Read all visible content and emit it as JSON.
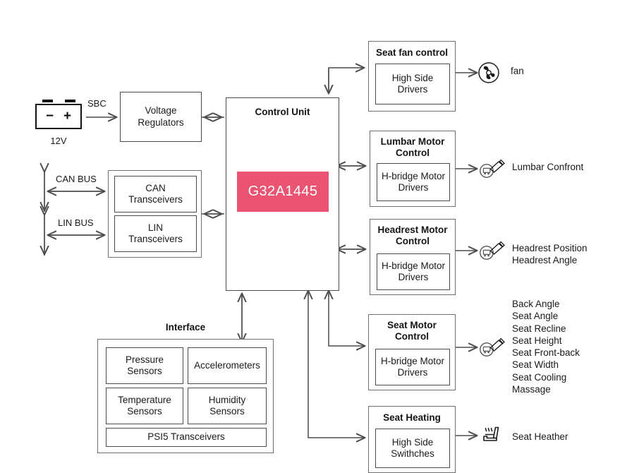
{
  "diagram": {
    "title_chip": "G32A1445",
    "accent_color": "#ea5472",
    "line_color": "#4c4c4c"
  },
  "power": {
    "battery_minus": "−",
    "battery_plus": "+",
    "battery_caption": "12V",
    "sbc_label": "SBC",
    "regulators_label": "Voltage\nRegulators"
  },
  "buses": [
    {
      "name": "CAN BUS",
      "transceiver": "CAN\nTransceivers"
    },
    {
      "name": "LIN BUS",
      "transceiver": "LIN\nTransceivers"
    }
  ],
  "control_unit": {
    "title": "Control Unit",
    "chip": "G32A1445"
  },
  "interface": {
    "title": "Interface",
    "blocks": [
      {
        "label": "Pressure\nSensors"
      },
      {
        "label": "Accelerometers"
      },
      {
        "label": "Temperature\nSensors"
      },
      {
        "label": "Humidity\nSensors"
      },
      {
        "label": "PSI5 Transceivers"
      }
    ]
  },
  "peripherals": [
    {
      "title": "Seat fan control",
      "driver": "High Side\nDrivers",
      "icon": "fan-icon",
      "output": "fan"
    },
    {
      "title": "Lumbar Motor\nControl",
      "driver": "H-bridge Motor\nDrivers",
      "icon": "motor-icon",
      "output": "Lumbar Confront"
    },
    {
      "title": "Headrest Motor\nControl",
      "driver": "H-bridge Motor\nDrivers",
      "icon": "motor-icon",
      "output": "Headrest Position\nHeadrest Angle"
    },
    {
      "title": "Seat Motor\nControl",
      "driver": "H-bridge Motor\nDrivers",
      "icon": "motor-icon",
      "output": "Back Angle\nSeat Angle\nSeat Recline\nSeat Height\nSeat Front-back\nSeat Width\nSeat Cooling\nMassage"
    },
    {
      "title": "Seat Heating",
      "driver": "High Side\nSwithches",
      "icon": "seat-heater-icon",
      "output": "Seat Heather"
    }
  ]
}
